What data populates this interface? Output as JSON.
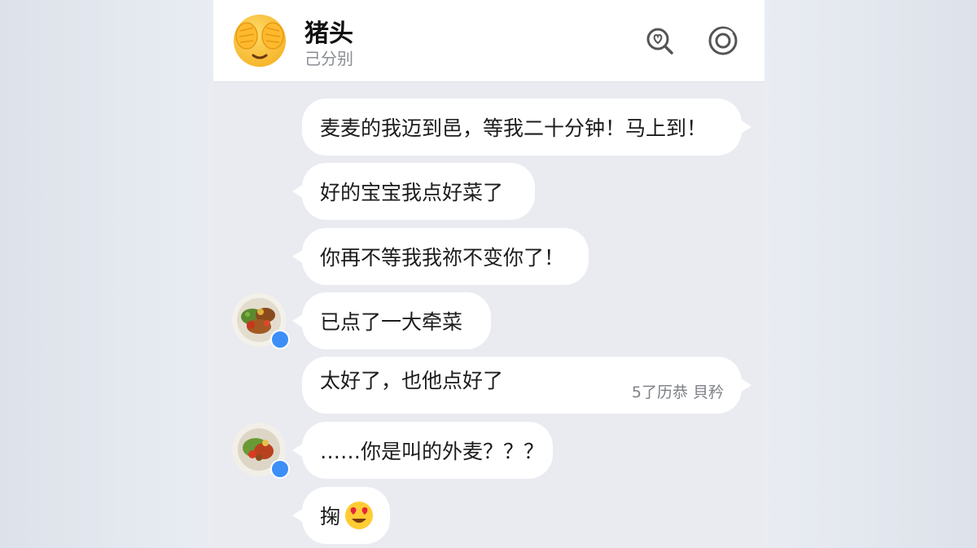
{
  "header": {
    "title": "猪头",
    "subtitle": "己分别",
    "search_icon": "search-heart-icon",
    "more_icon": "circle-menu-icon"
  },
  "messages": [
    {
      "side": "right",
      "text": "麦麦的我迈到邑，等我二十分钟！马上到！"
    },
    {
      "side": "left",
      "text": "好的宝宝我点好菜了"
    },
    {
      "side": "right",
      "text": "你再不等我我祢不变你了！"
    },
    {
      "side": "left",
      "text": "已点了一大牵菜",
      "avatar": "food-plate-avatar"
    },
    {
      "side": "right",
      "text": "太好了，也他点好了",
      "meta": "5了历恭  貝矜"
    },
    {
      "side": "left",
      "text": "……你是叫的外麦？？？",
      "avatar": "food-plate-avatar"
    },
    {
      "side": "right",
      "text": "掬",
      "emoji": "heart-eyes-emoji"
    }
  ],
  "colors": {
    "background": "#e9ebf1",
    "bubble": "#ffffff",
    "badge": "#3d8ff7"
  }
}
